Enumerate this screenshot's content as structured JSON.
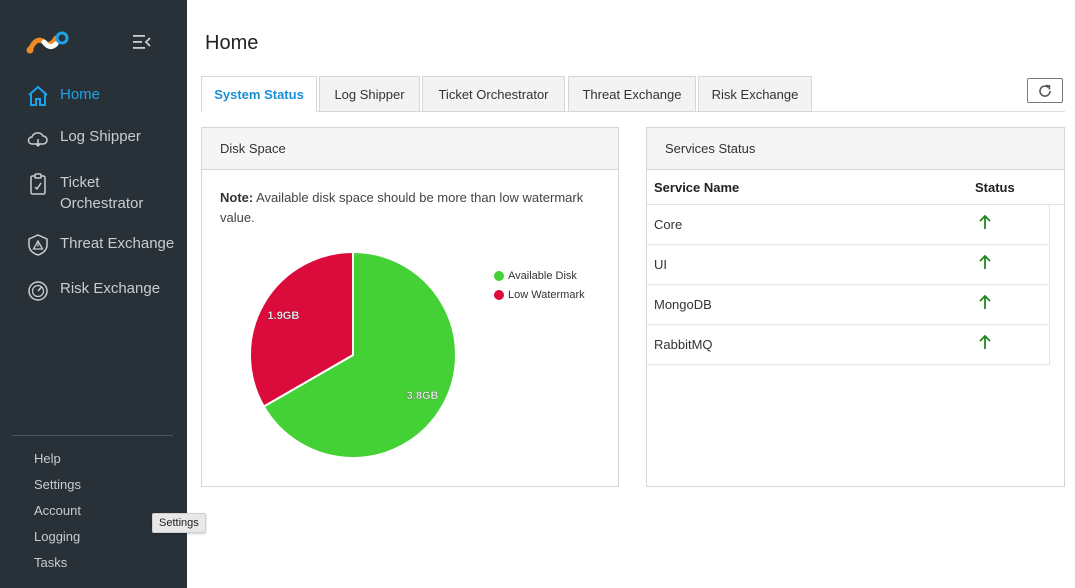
{
  "sidebar": {
    "nav": [
      {
        "label": "Home",
        "icon": "home-icon",
        "active": true
      },
      {
        "label": "Log Shipper",
        "icon": "cloud-icon"
      },
      {
        "label": "Ticket\nOrchestrator",
        "icon": "clipboard-icon"
      },
      {
        "label": "Threat Exchange",
        "icon": "warning-shield-icon"
      },
      {
        "label": "Risk Exchange",
        "icon": "gauge-icon"
      }
    ],
    "bottom_links": [
      "Help",
      "Settings",
      "Account",
      "Logging",
      "Tasks"
    ],
    "tooltip": "Settings",
    "accent_color": "#1aa3e8"
  },
  "page": {
    "title": "Home",
    "tabs": [
      "System Status",
      "Log Shipper",
      "Ticket Orchestrator",
      "Threat Exchange",
      "Risk Exchange"
    ],
    "active_tab": "System Status"
  },
  "disk": {
    "header": "Disk Space",
    "note_label": "Note:",
    "note_text": "Available disk space should be more than low watermark value."
  },
  "services": {
    "header": "Services Status",
    "columns": [
      "Service Name",
      "Status"
    ],
    "rows": [
      {
        "name": "Core",
        "status": "up"
      },
      {
        "name": "UI",
        "status": "up"
      },
      {
        "name": "MongoDB",
        "status": "up"
      },
      {
        "name": "RabbitMQ",
        "status": "up"
      }
    ],
    "status_color": "#1e8a1e"
  },
  "chart_data": {
    "type": "pie",
    "slices": [
      {
        "label": "Available Disk",
        "value": 3.8,
        "display": "3.8GB",
        "color": "#44d135"
      },
      {
        "label": "Low Watermark",
        "value": 1.9,
        "display": "1.9GB",
        "color": "#db0b3c"
      }
    ],
    "legend_position": "right"
  }
}
